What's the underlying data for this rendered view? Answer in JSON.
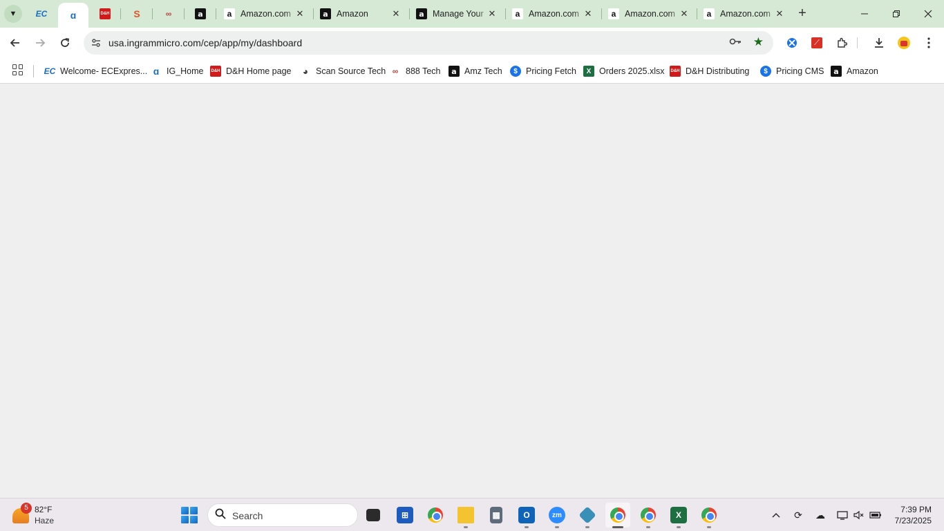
{
  "browser": {
    "pinned_tabs": [
      {
        "icon": "ecexpress-icon",
        "glyph": "EC"
      },
      {
        "icon": "ingram-micro-icon",
        "glyph": "ɑ"
      },
      {
        "icon": "dh-icon",
        "glyph": "D&H"
      },
      {
        "icon": "sync-icon",
        "glyph": "S"
      },
      {
        "icon": "888-icon",
        "glyph": "∞"
      },
      {
        "icon": "amazon-icon",
        "glyph": "a"
      }
    ],
    "tabs": [
      {
        "title": "Amazon.com",
        "icon": "amazon-smile-icon"
      },
      {
        "title": "Amazon",
        "icon": "amazon-icon"
      },
      {
        "title": "Manage Your",
        "icon": "amazon-icon"
      },
      {
        "title": "Amazon.com",
        "icon": "amazon-smile-icon"
      },
      {
        "title": "Amazon.com",
        "icon": "amazon-smile-icon"
      },
      {
        "title": "Amazon.com",
        "icon": "amazon-smile-icon"
      }
    ],
    "url": "usa.ingrammicro.com/cep/app/my/dashboard",
    "bookmarks": [
      {
        "label": "Welcome- ECExpres...",
        "icon": "ecexpress-icon",
        "glyph": "EC"
      },
      {
        "label": "IG_Home",
        "icon": "ingram-micro-icon",
        "glyph": "ɑ"
      },
      {
        "label": "D&H Home page",
        "icon": "dh-icon",
        "glyph": "D&H"
      },
      {
        "label": "Scan Source Tech",
        "icon": "globe-icon",
        "glyph": "◕"
      },
      {
        "label": "888 Tech",
        "icon": "888-icon",
        "glyph": "∞"
      },
      {
        "label": "Amz Tech",
        "icon": "amazon-icon",
        "glyph": "a"
      },
      {
        "label": "Pricing Fetch",
        "icon": "pricing-icon",
        "glyph": "$"
      },
      {
        "label": "Orders 2025.xlsx",
        "icon": "excel-icon",
        "glyph": "X"
      },
      {
        "label": "D&H Distributing",
        "icon": "dh-icon",
        "glyph": "D&H"
      },
      {
        "label": "Pricing CMS",
        "icon": "pricing-icon",
        "glyph": "$"
      },
      {
        "label": "Amazon",
        "icon": "amazon-icon",
        "glyph": "a"
      }
    ]
  },
  "taskbar": {
    "weather": {
      "alerts": "5",
      "temp": "82°F",
      "condition": "Haze"
    },
    "search_placeholder": "Search",
    "time": "7:39 PM",
    "date": "7/23/2025"
  },
  "colors": {
    "tabstrip": "#d6e9d4",
    "toolbar": "#ffffff",
    "page": "#efefef",
    "taskbar": "#ece8ee"
  }
}
